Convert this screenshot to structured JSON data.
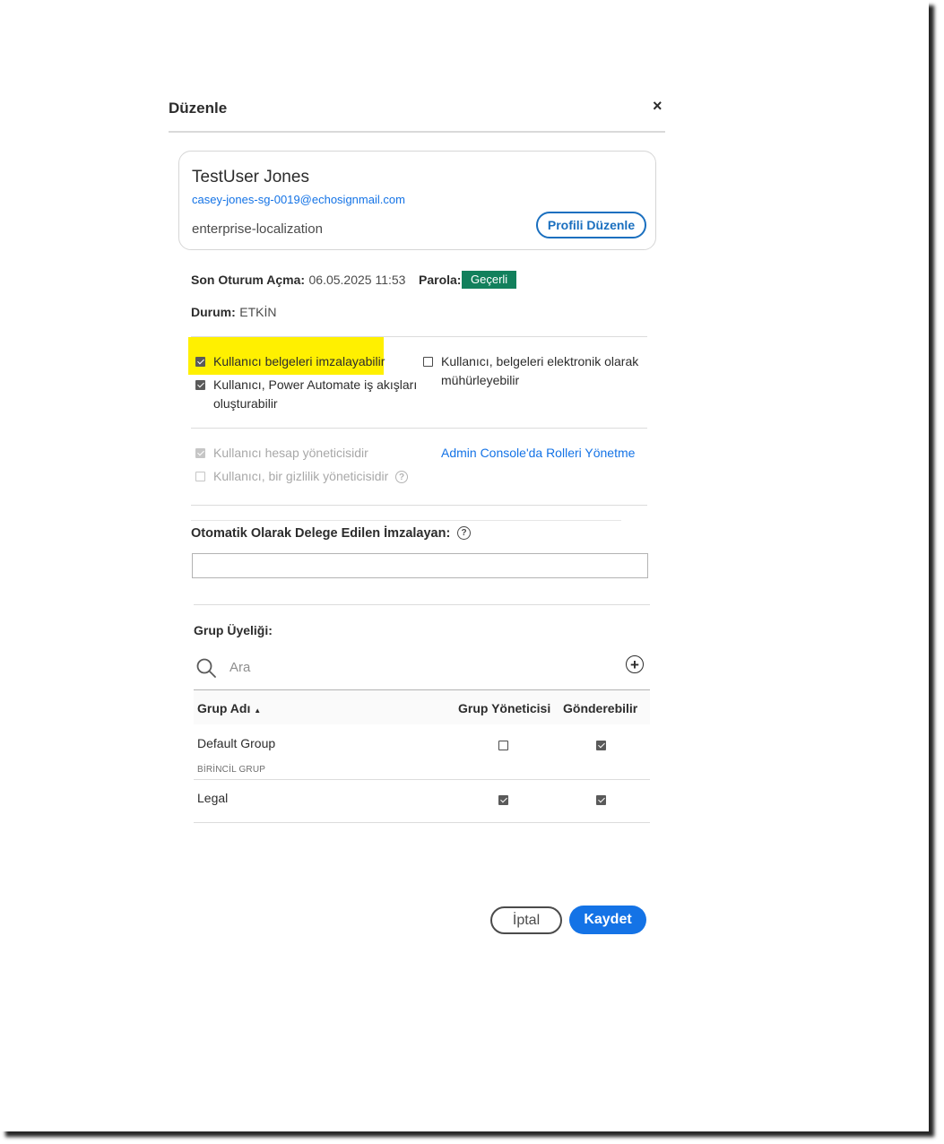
{
  "dialog": {
    "title": "Düzenle",
    "close_label": "×"
  },
  "user": {
    "name": "TestUser Jones",
    "email": "casey-jones-sg-0019@echosignmail.com",
    "organization": "enterprise-localization",
    "edit_profile_label": "Profili Düzenle"
  },
  "info": {
    "last_login_label": "Son Oturum Açma:",
    "last_login_value": "06.05.2025 11:53",
    "password_label": "Parola:",
    "password_status": "Geçerli",
    "status_label": "Durum:",
    "status_value": "ETKİN"
  },
  "permissions": {
    "can_sign": {
      "label": "Kullanıcı belgeleri imzalayabilir",
      "checked": true
    },
    "power_automate": {
      "label_line1": "Kullanıcı, Power Automate iş akışları",
      "label_line2": "oluşturabilir",
      "checked": true
    },
    "can_seal": {
      "label_line1": "Kullanıcı, belgeleri elektronik olarak",
      "label_line2": "mühürleyebilir",
      "checked": false
    }
  },
  "roles": {
    "account_admin": {
      "label": "Kullanıcı hesap yöneticisidir",
      "checked": true,
      "disabled": true
    },
    "privacy_admin": {
      "label": "Kullanıcı, bir gizlilik yöneticisidir",
      "checked": false,
      "disabled": true
    },
    "help_icon": "?",
    "manage_roles_link": "Admin Console'da Rolleri Yönetme"
  },
  "delegate": {
    "label": "Otomatik Olarak Delege Edilen İmzalayan:",
    "help_icon": "?",
    "value": ""
  },
  "groups": {
    "title": "Grup Üyeliği:",
    "search_placeholder": "Ara",
    "add_icon": "+",
    "columns": {
      "name": "Grup Adı",
      "sort_indicator": "▲",
      "group_admin": "Grup Yöneticisi",
      "can_send": "Gönderebilir"
    },
    "rows": [
      {
        "name": "Default Group",
        "subtitle": "BİRİNCİL GRUP",
        "group_admin": false,
        "can_send": true
      },
      {
        "name": "Legal",
        "subtitle": "",
        "group_admin": true,
        "can_send": true
      }
    ]
  },
  "footer": {
    "cancel_label": "İptal",
    "save_label": "Kaydet"
  }
}
